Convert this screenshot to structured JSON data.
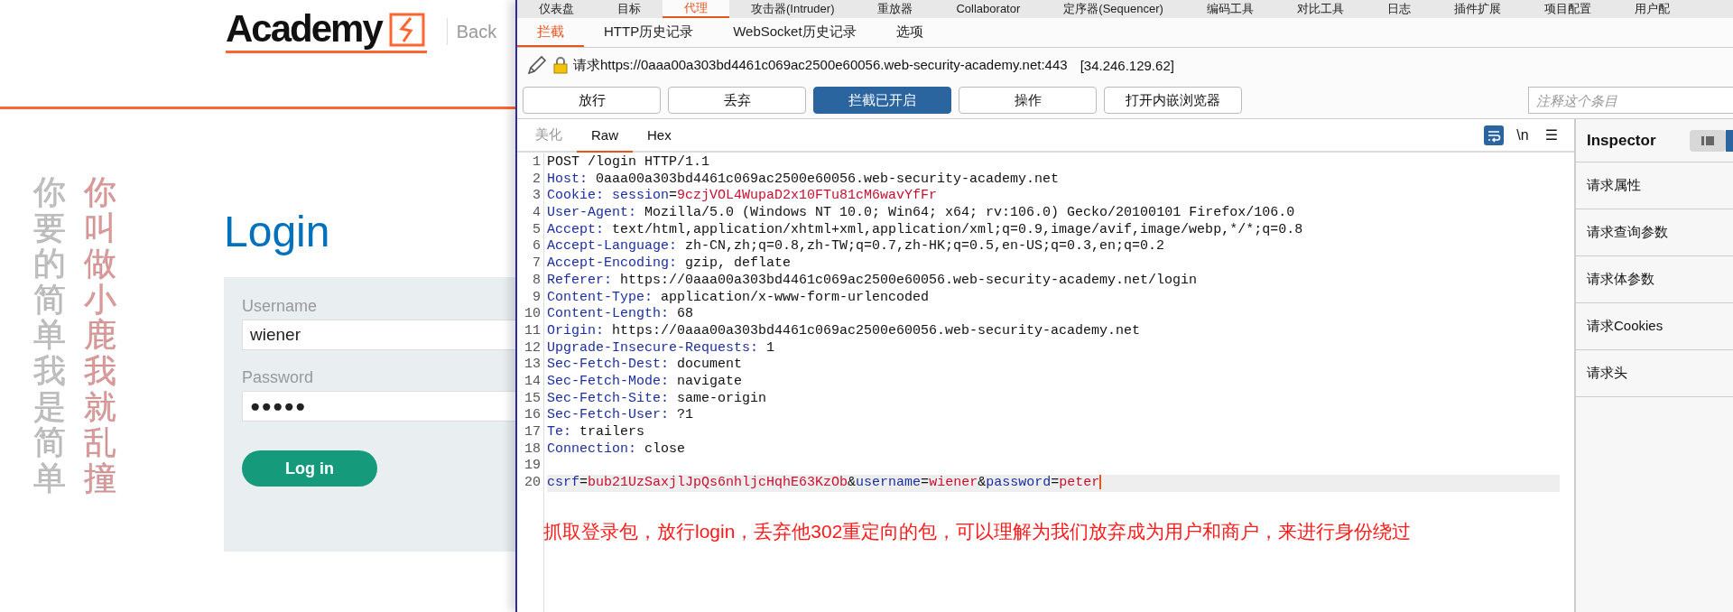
{
  "site": {
    "logo_text": "Academy",
    "back_link": "Back",
    "vertical_texts": [
      {
        "text": "你要的简单我是简单",
        "color": "#c4c4c4"
      },
      {
        "text": "你叫做小鹿我就乱撞",
        "color": "#e79a9a"
      }
    ],
    "login": {
      "heading": "Login",
      "username_label": "Username",
      "username_value": "wiener",
      "password_label": "Password",
      "password_value": "●●●●●",
      "button": "Log in"
    }
  },
  "burp": {
    "top_tabs": [
      {
        "label": "仪表盘",
        "selected": false
      },
      {
        "label": "目标",
        "selected": false
      },
      {
        "label": "代理",
        "selected": true
      },
      {
        "label": "攻击器(Intruder)",
        "selected": false
      },
      {
        "label": "重放器",
        "selected": false
      },
      {
        "label": "Collaborator",
        "selected": false
      },
      {
        "label": "定序器(Sequencer)",
        "selected": false
      },
      {
        "label": "编码工具",
        "selected": false
      },
      {
        "label": "对比工具",
        "selected": false
      },
      {
        "label": "日志",
        "selected": false
      },
      {
        "label": "插件扩展",
        "selected": false
      },
      {
        "label": "项目配置",
        "selected": false
      },
      {
        "label": "用户配",
        "selected": false
      }
    ],
    "sub_tabs": [
      {
        "label": "拦截",
        "selected": true
      },
      {
        "label": "HTTP历史记录",
        "selected": false
      },
      {
        "label": "WebSocket历史记录",
        "selected": false
      },
      {
        "label": "选项",
        "selected": false
      }
    ],
    "request_url": "请求https://0aaa00a303bd4461c069ac2500e60056.web-security-academy.net:443",
    "request_ip": "[34.246.129.62]",
    "buttons": [
      {
        "label": "放行",
        "selected": false
      },
      {
        "label": "丢弃",
        "selected": false
      },
      {
        "label": "拦截已开启",
        "selected": true
      },
      {
        "label": "操作",
        "selected": false
      },
      {
        "label": "打开内嵌浏览器",
        "selected": false
      }
    ],
    "comment_field": {
      "placeholder": "注释这个条目"
    },
    "editor_tabs": [
      {
        "label": "美化",
        "selected": false,
        "disabled": true
      },
      {
        "label": "Raw",
        "selected": true,
        "disabled": false
      },
      {
        "label": "Hex",
        "selected": false,
        "disabled": false
      }
    ],
    "newline_toggle": "\\n",
    "menu_glyph": "☰",
    "lines": [
      {
        "number": "1",
        "selected": false,
        "tokens": [
          {
            "text": "POST /login HTTP/1.1",
            "kind": "plain"
          }
        ]
      },
      {
        "number": "2",
        "selected": false,
        "tokens": [
          {
            "text": "Host:",
            "kind": "name"
          },
          {
            "text": " 0aaa00a303bd4461c069ac2500e60056.web-security-academy.net",
            "kind": "plain"
          }
        ]
      },
      {
        "number": "3",
        "selected": false,
        "tokens": [
          {
            "text": "Cookie: session",
            "kind": "name"
          },
          {
            "text": "=",
            "kind": "plain"
          },
          {
            "text": "9czjVOL4WupaD2x10FTu81cM6wavYfFr",
            "kind": "value"
          }
        ]
      },
      {
        "number": "4",
        "selected": false,
        "tokens": [
          {
            "text": "User-Agent:",
            "kind": "name"
          },
          {
            "text": " Mozilla/5.0 (Windows NT 10.0; Win64; x64; rv:106.0) Gecko/20100101 Firefox/106.0",
            "kind": "plain"
          }
        ]
      },
      {
        "number": "5",
        "selected": false,
        "tokens": [
          {
            "text": "Accept:",
            "kind": "name"
          },
          {
            "text": " text/html,application/xhtml+xml,application/xml;q=0.9,image/avif,image/webp,*/*;q=0.8",
            "kind": "plain"
          }
        ]
      },
      {
        "number": "6",
        "selected": false,
        "tokens": [
          {
            "text": "Accept-Language:",
            "kind": "name"
          },
          {
            "text": " zh-CN,zh;q=0.8,zh-TW;q=0.7,zh-HK;q=0.5,en-US;q=0.3,en;q=0.2",
            "kind": "plain"
          }
        ]
      },
      {
        "number": "7",
        "selected": false,
        "tokens": [
          {
            "text": "Accept-Encoding:",
            "kind": "name"
          },
          {
            "text": " gzip, deflate",
            "kind": "plain"
          }
        ]
      },
      {
        "number": "8",
        "selected": false,
        "tokens": [
          {
            "text": "Referer:",
            "kind": "name"
          },
          {
            "text": " https://0aaa00a303bd4461c069ac2500e60056.web-security-academy.net/login",
            "kind": "plain"
          }
        ]
      },
      {
        "number": "9",
        "selected": false,
        "tokens": [
          {
            "text": "Content-Type:",
            "kind": "name"
          },
          {
            "text": " application/x-www-form-urlencoded",
            "kind": "plain"
          }
        ]
      },
      {
        "number": "10",
        "selected": false,
        "tokens": [
          {
            "text": "Content-Length:",
            "kind": "name"
          },
          {
            "text": " 68",
            "kind": "plain"
          }
        ]
      },
      {
        "number": "11",
        "selected": false,
        "tokens": [
          {
            "text": "Origin:",
            "kind": "name"
          },
          {
            "text": " https://0aaa00a303bd4461c069ac2500e60056.web-security-academy.net",
            "kind": "plain"
          }
        ]
      },
      {
        "number": "12",
        "selected": false,
        "tokens": [
          {
            "text": "Upgrade-Insecure-Requests:",
            "kind": "name"
          },
          {
            "text": " 1",
            "kind": "plain"
          }
        ]
      },
      {
        "number": "13",
        "selected": false,
        "tokens": [
          {
            "text": "Sec-Fetch-Dest:",
            "kind": "name"
          },
          {
            "text": " document",
            "kind": "plain"
          }
        ]
      },
      {
        "number": "14",
        "selected": false,
        "tokens": [
          {
            "text": "Sec-Fetch-Mode:",
            "kind": "name"
          },
          {
            "text": " navigate",
            "kind": "plain"
          }
        ]
      },
      {
        "number": "15",
        "selected": false,
        "tokens": [
          {
            "text": "Sec-Fetch-Site:",
            "kind": "name"
          },
          {
            "text": " same-origin",
            "kind": "plain"
          }
        ]
      },
      {
        "number": "16",
        "selected": false,
        "tokens": [
          {
            "text": "Sec-Fetch-User:",
            "kind": "name"
          },
          {
            "text": " ?1",
            "kind": "plain"
          }
        ]
      },
      {
        "number": "17",
        "selected": false,
        "tokens": [
          {
            "text": "Te:",
            "kind": "name"
          },
          {
            "text": " trailers",
            "kind": "plain"
          }
        ]
      },
      {
        "number": "18",
        "selected": false,
        "tokens": [
          {
            "text": "Connection:",
            "kind": "name"
          },
          {
            "text": " close",
            "kind": "plain"
          }
        ]
      },
      {
        "number": "19",
        "selected": false
      },
      {
        "number": "20",
        "selected": true,
        "tokens": [
          {
            "text": "csrf",
            "kind": "name"
          },
          {
            "text": "=",
            "kind": "plain"
          },
          {
            "text": "bub21UzSaxjlJpQs6nhljcHqhE63KzOb",
            "kind": "value"
          },
          {
            "text": "&",
            "kind": "plain"
          },
          {
            "text": "username",
            "kind": "name"
          },
          {
            "text": "=",
            "kind": "plain"
          },
          {
            "text": "wiener",
            "kind": "value"
          },
          {
            "text": "&",
            "kind": "plain"
          },
          {
            "text": "password",
            "kind": "name"
          },
          {
            "text": "=",
            "kind": "plain"
          },
          {
            "text": "peter",
            "kind": "value"
          }
        ]
      }
    ],
    "annotation": "抓取登录包，放行login，丢弃他302重定向的包，可以理解为我们放弃成为用户和商户，来进行身份绕过",
    "inspector": {
      "title": "Inspector",
      "items": [
        "请求属性",
        "请求查询参数",
        "请求体参数",
        "请求Cookies",
        "请求头"
      ]
    }
  }
}
